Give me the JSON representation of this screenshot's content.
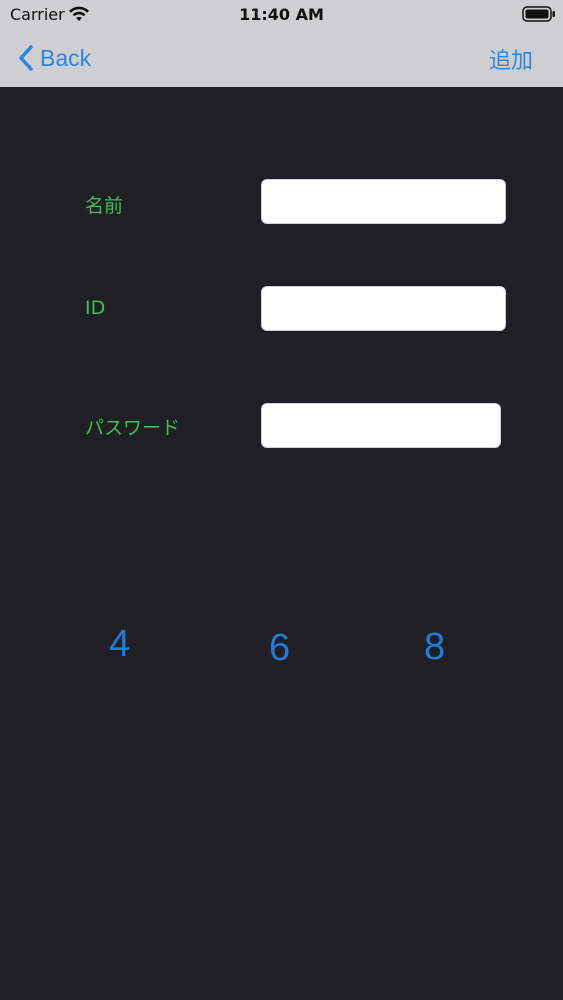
{
  "status_bar": {
    "carrier": "Carrier",
    "time": "11:40 AM"
  },
  "navbar": {
    "back_label": "Back",
    "add_label": "追加"
  },
  "form": {
    "name_label": "名前",
    "name_value": "",
    "id_label": "ID",
    "id_value": "",
    "password_label": "パスワード",
    "password_value": ""
  },
  "numbers": [
    "4",
    "6",
    "8"
  ],
  "colors": {
    "background": "#1f1f24",
    "navbar": "#cfcfd1",
    "accent_blue": "#2a86e6",
    "label_green": "#3fbf55"
  },
  "icons": {
    "wifi": "wifi-icon",
    "battery": "battery-icon",
    "back": "chevron-left-icon"
  }
}
